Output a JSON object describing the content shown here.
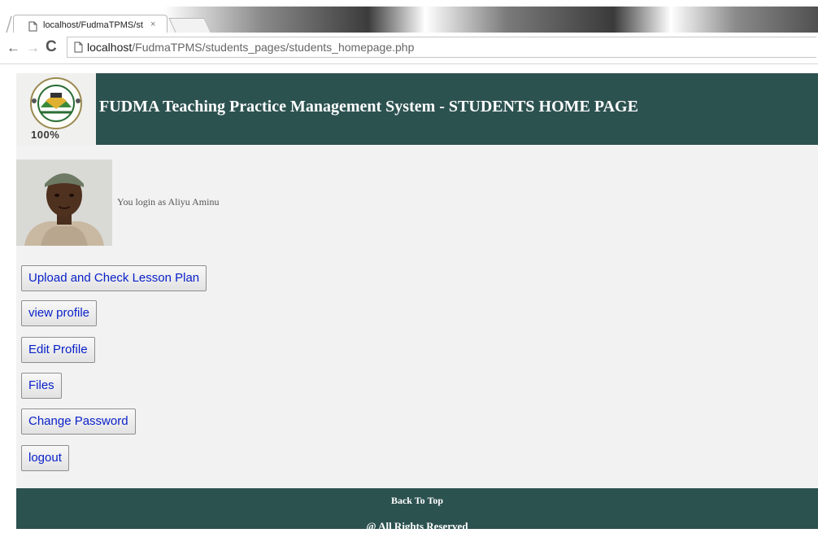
{
  "browser": {
    "tab_title": "localhost/FudmaTPMS/st",
    "tab_close": "×",
    "url_host": "localhost",
    "url_path": "/FudmaTPMS/students_pages/students_homepage.php",
    "back_glyph": "←",
    "forward_glyph": "→",
    "reload_glyph": "C"
  },
  "header": {
    "title": "FUDMA Teaching Practice Management System - STUDENTS HOME PAGE",
    "logo_text": "100%"
  },
  "user": {
    "login_text": "You login as Aliyu Aminu"
  },
  "menu": {
    "upload_lesson_plan": "Upload and Check Lesson Plan",
    "view_profile": "view profile",
    "edit_profile": "Edit Profile",
    "files": "Files",
    "change_password": "Change Password",
    "logout": "logout"
  },
  "footer": {
    "back_to_top": "Back To Top",
    "rights": "@ All Rights Reserved"
  },
  "colors": {
    "header_bg": "#2c5250",
    "page_bg": "#f2f2f2",
    "button_text": "#0a21c9"
  },
  "icons": [
    "page-icon",
    "back-arrow-icon",
    "forward-arrow-icon",
    "reload-icon",
    "close-icon"
  ]
}
